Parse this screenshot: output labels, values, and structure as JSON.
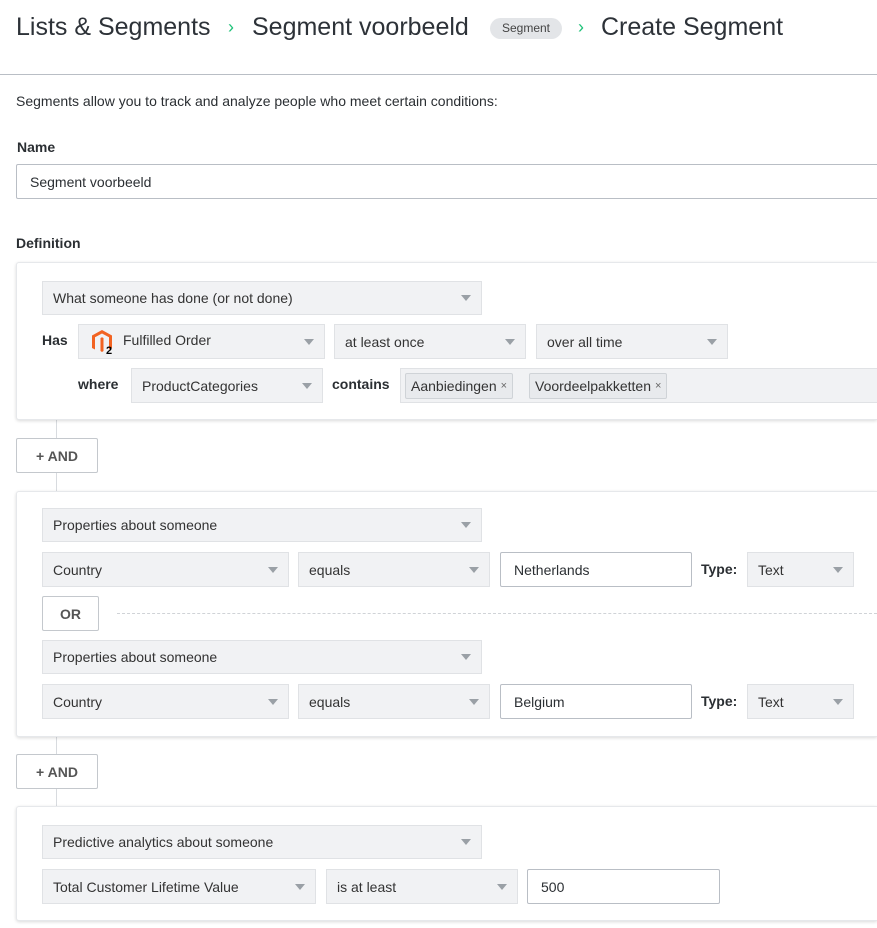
{
  "breadcrumb": {
    "items": [
      "Lists & Segments",
      "Segment voorbeeld",
      "Create Segment"
    ],
    "badge": "Segment",
    "separator": "›"
  },
  "description": "Segments allow you to track and analyze people who meet certain conditions:",
  "name": {
    "label": "Name",
    "value": "Segment voorbeeld"
  },
  "definition": {
    "label": "Definition"
  },
  "condition1": {
    "type": "What someone has done (or not done)",
    "has_label": "Has",
    "event": "Fulfilled Order",
    "frequency": "at least once",
    "timeframe": "over all time",
    "where_label": "where",
    "property": "ProductCategories",
    "operator": "contains",
    "tags": [
      "Aanbiedingen",
      "Voordeelpakketten"
    ],
    "tag_remove": "×",
    "event_icon": "magento-2-icon"
  },
  "and_button": "+ AND",
  "condition2": {
    "type": "Properties about someone",
    "property": "Country",
    "operator": "equals",
    "value": "Netherlands",
    "type_label": "Type:",
    "value_type": "Text",
    "or_button": "OR",
    "or_type": "Properties about someone",
    "or_property": "Country",
    "or_operator": "equals",
    "or_value": "Belgium",
    "or_type_label": "Type:",
    "or_value_type": "Text"
  },
  "condition3": {
    "type": "Predictive analytics about someone",
    "property": "Total Customer Lifetime Value",
    "operator": "is at least",
    "value": "500"
  },
  "colors": {
    "accent": "#20c27a",
    "magento": "#f26322"
  }
}
